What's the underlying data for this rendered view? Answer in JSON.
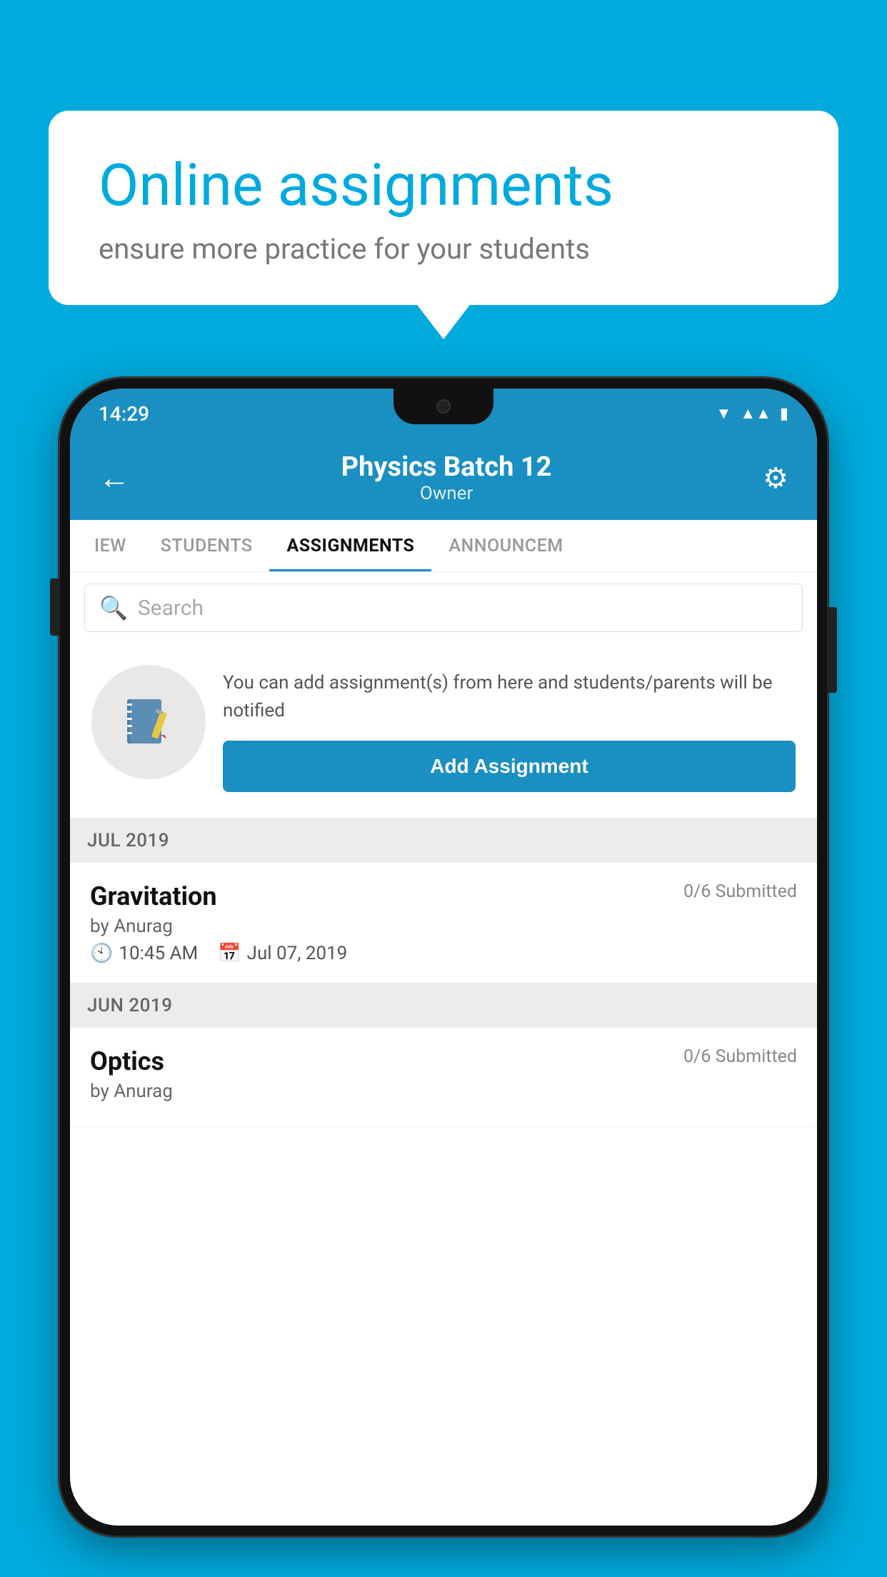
{
  "background_color": "#00AADD",
  "speech_bubble": {
    "title": "Online assignments",
    "subtitle": "ensure more practice for your students"
  },
  "phone": {
    "status_bar": {
      "time": "14:29"
    },
    "header": {
      "title": "Physics Batch 12",
      "subtitle": "Owner",
      "back_label": "←",
      "settings_label": "⚙"
    },
    "tabs": [
      {
        "label": "IEW",
        "active": false
      },
      {
        "label": "STUDENTS",
        "active": false
      },
      {
        "label": "ASSIGNMENTS",
        "active": true
      },
      {
        "label": "ANNOUNCEM",
        "active": false
      }
    ],
    "search": {
      "placeholder": "Search"
    },
    "promo_card": {
      "description": "You can add assignment(s) from here and students/parents will be notified",
      "button_label": "Add Assignment"
    },
    "sections": [
      {
        "label": "JUL 2019",
        "assignments": [
          {
            "name": "Gravitation",
            "submitted": "0/6 Submitted",
            "author": "by Anurag",
            "time": "10:45 AM",
            "date": "Jul 07, 2019"
          }
        ]
      },
      {
        "label": "JUN 2019",
        "assignments": [
          {
            "name": "Optics",
            "submitted": "0/6 Submitted",
            "author": "by Anurag",
            "time": "",
            "date": ""
          }
        ]
      }
    ]
  }
}
